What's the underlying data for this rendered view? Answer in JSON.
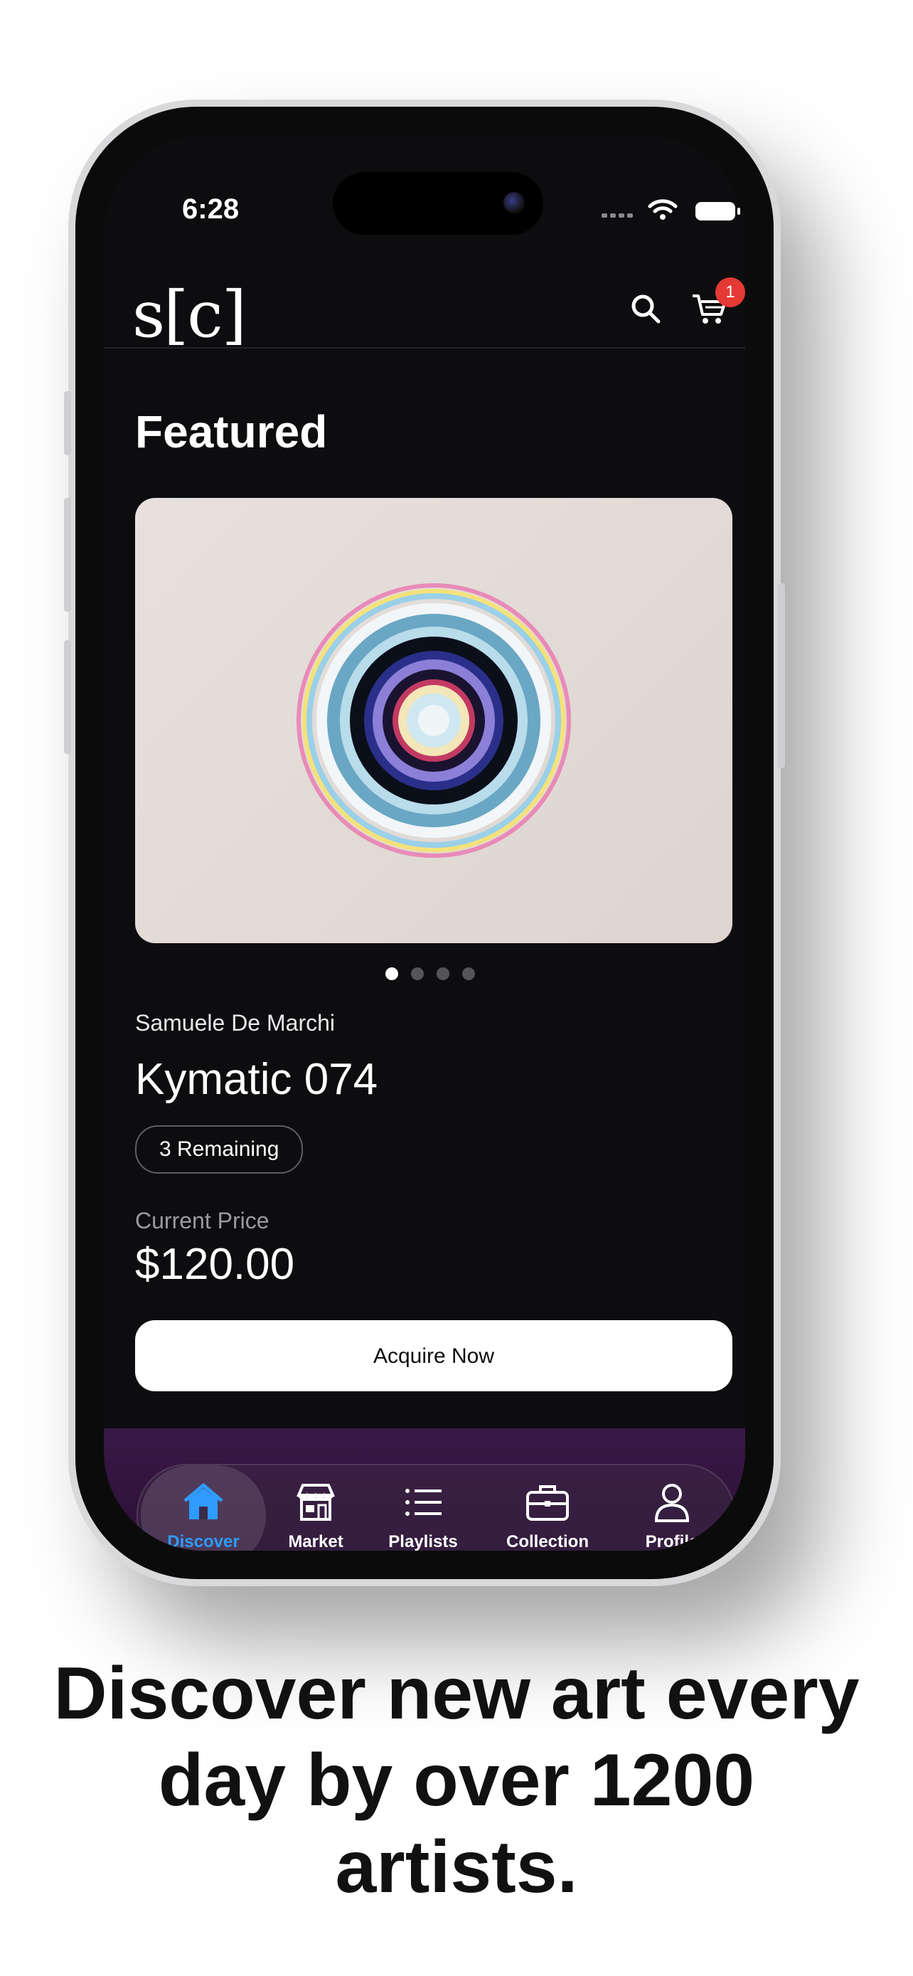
{
  "status_bar": {
    "time": "6:28"
  },
  "header": {
    "logo": "s[c]",
    "cart_badge": "1"
  },
  "featured": {
    "title": "Featured",
    "carousel": {
      "count": 4,
      "active_index": 0
    },
    "artist": "Samuele De Marchi",
    "artwork_title": "Kymatic 074",
    "remaining": "3 Remaining",
    "price_label": "Current Price",
    "price": "$120.00",
    "cta": "Acquire Now"
  },
  "tabbar": {
    "items": [
      {
        "label": "Discover",
        "icon": "home-icon",
        "active": true
      },
      {
        "label": "Market",
        "icon": "storefront-icon",
        "active": false
      },
      {
        "label": "Playlists",
        "icon": "list-icon",
        "active": false
      },
      {
        "label": "Collection",
        "icon": "briefcase-icon",
        "active": false
      },
      {
        "label": "Profile",
        "icon": "person-icon",
        "active": false
      }
    ]
  },
  "caption": "Discover new art every day by over 1200 artists.",
  "colors": {
    "accent": "#2f9bff",
    "badge": "#e53935",
    "background": "#0d0d0f"
  }
}
